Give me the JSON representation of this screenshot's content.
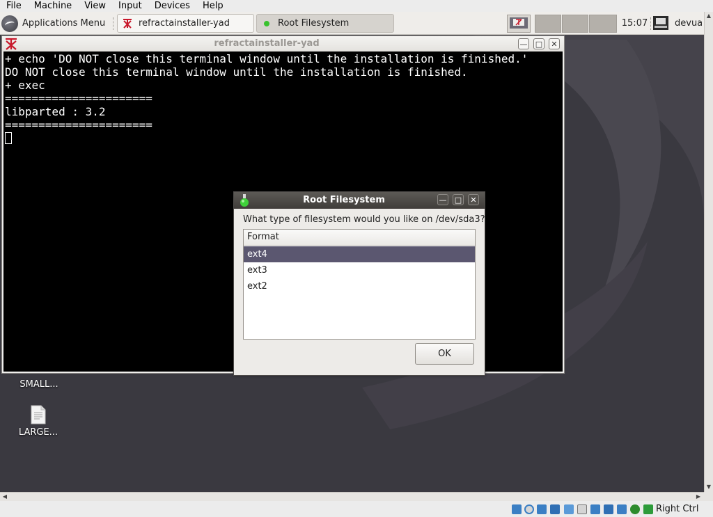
{
  "host_menubar": [
    "File",
    "Machine",
    "View",
    "Input",
    "Devices",
    "Help"
  ],
  "panel": {
    "app_menu_label": "Applications Menu",
    "tasks": [
      {
        "label": "refractainstaller-yad"
      },
      {
        "label": "Root Filesystem"
      }
    ],
    "clock": "15:07",
    "user": "devua"
  },
  "terminal": {
    "title": "refractainstaller-yad",
    "lines": [
      "+ echo 'DO NOT close this terminal window until the installation is finished.'",
      "DO NOT close this terminal window until the installation is finished.",
      "+ exec",
      "======================",
      "libparted : 3.2",
      "======================"
    ]
  },
  "dialog": {
    "title": "Root Filesystem",
    "question": "What type of filesystem would you like on /dev/sda3?",
    "column_header": "Format",
    "options": [
      "ext4",
      "ext3",
      "ext2"
    ],
    "selected": "ext4",
    "ok_label": "OK"
  },
  "desktop_icons": [
    {
      "label": "SMALL..."
    },
    {
      "label": "LARGE..."
    }
  ],
  "statusbar": {
    "host_key": "Right Ctrl",
    "icons": [
      "hard-disk-icon",
      "optical-disk-icon",
      "audio-icon",
      "network-icon",
      "usb-icon",
      "shared-folder-icon",
      "display-icon",
      "video-capture-icon",
      "recording-icon",
      "cpu-icon",
      "mouse-integration-icon",
      "keyboard-capture-icon"
    ]
  },
  "colors": {
    "selection": "#5b5770",
    "dialog_titlebar": "#3f3c39",
    "desktop": "#3a3940",
    "terminal_bg": "#000000"
  }
}
